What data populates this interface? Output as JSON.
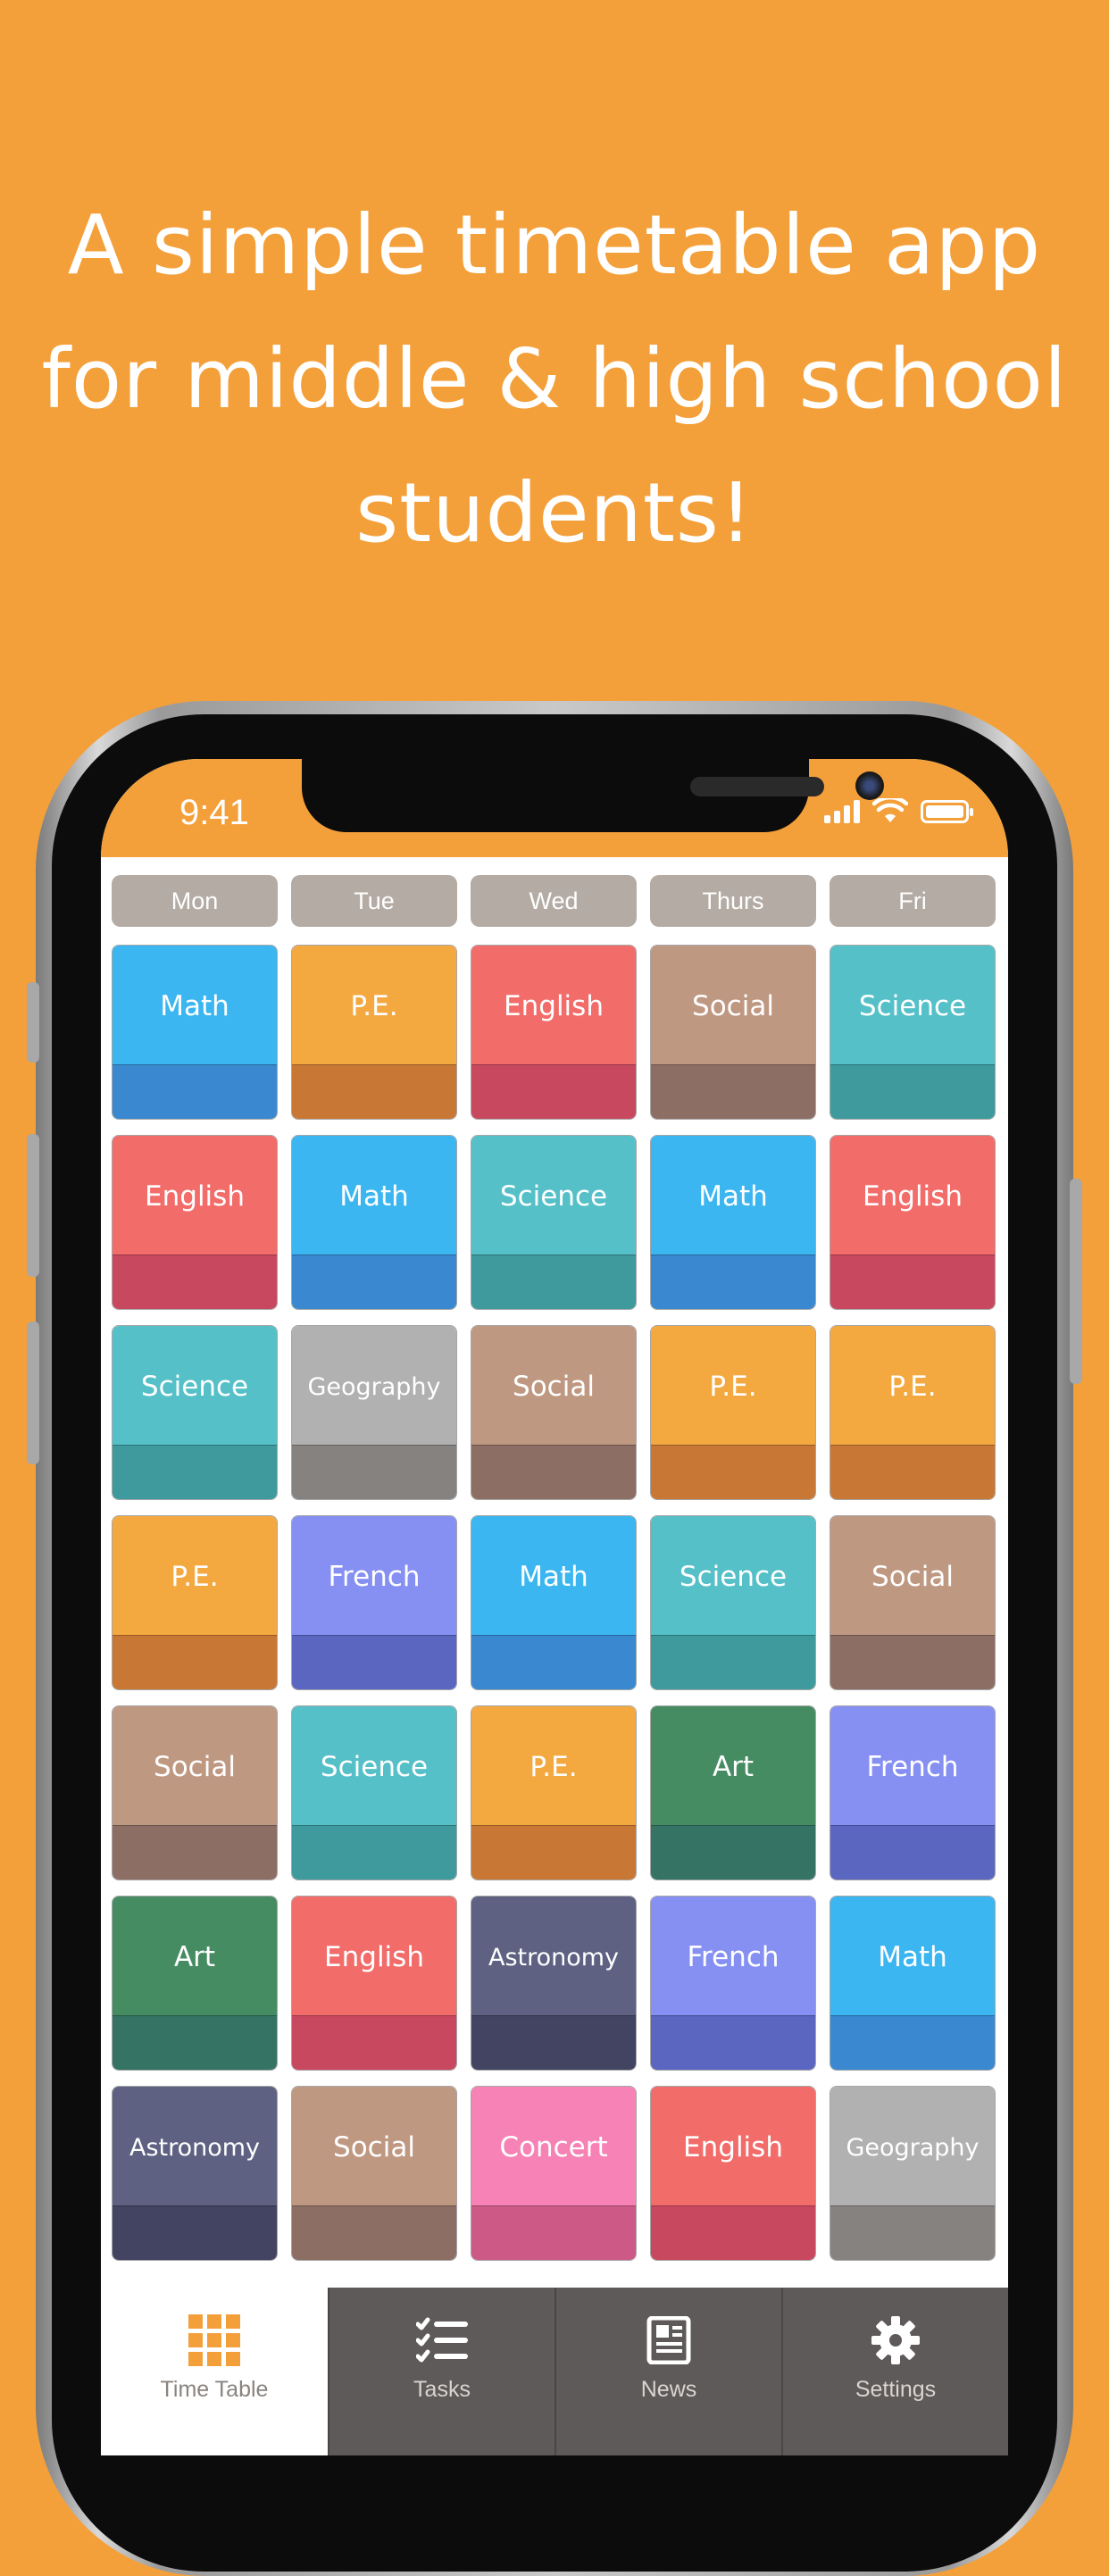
{
  "headline": {
    "line1": "A simple timetable app",
    "line2": "for middle & high school",
    "line3": "students!"
  },
  "status_bar": {
    "time": "9:41"
  },
  "days": [
    "Mon",
    "Tue",
    "Wed",
    "Thurs",
    "Fri"
  ],
  "subject_colors": {
    "Math": [
      "#3bb6f0",
      "#3a88cf"
    ],
    "P.E.": [
      "#f4a840",
      "#c87834"
    ],
    "English": [
      "#f26c6a",
      "#c84860"
    ],
    "Social": [
      "#bf9882",
      "#8c6e64"
    ],
    "Science": [
      "#55c0c8",
      "#3e9a9c"
    ],
    "Geography": [
      "#b1b1b1",
      "#868280"
    ],
    "French": [
      "#8690f2",
      "#5a66c0"
    ],
    "Art": [
      "#468c62",
      "#357364"
    ],
    "Astronomy": [
      "#5e6182",
      "#424462"
    ],
    "Concert": [
      "#f682b6",
      "#cd5a86"
    ]
  },
  "timetable": [
    [
      "Math",
      "P.E.",
      "English",
      "Social",
      "Science"
    ],
    [
      "English",
      "Math",
      "Science",
      "Math",
      "English"
    ],
    [
      "Science",
      "Geography",
      "Social",
      "P.E.",
      "P.E."
    ],
    [
      "P.E.",
      "French",
      "Math",
      "Science",
      "Social"
    ],
    [
      "Social",
      "Science",
      "P.E.",
      "Art",
      "French"
    ],
    [
      "Art",
      "English",
      "Astronomy",
      "French",
      "Math"
    ],
    [
      "Astronomy",
      "Social",
      "Concert",
      "English",
      "Geography"
    ]
  ],
  "tabs": [
    {
      "label": "Time Table",
      "icon": "grid-icon",
      "active": true
    },
    {
      "label": "Tasks",
      "icon": "checklist-icon",
      "active": false
    },
    {
      "label": "News",
      "icon": "newspaper-icon",
      "active": false
    },
    {
      "label": "Settings",
      "icon": "gear-icon",
      "active": false
    }
  ],
  "colors": {
    "brand": "#f4a03a",
    "day_header": "#b4aca4",
    "tab_inactive_bg": "#5f5a5a",
    "tab_active_bg": "#ffffff"
  }
}
